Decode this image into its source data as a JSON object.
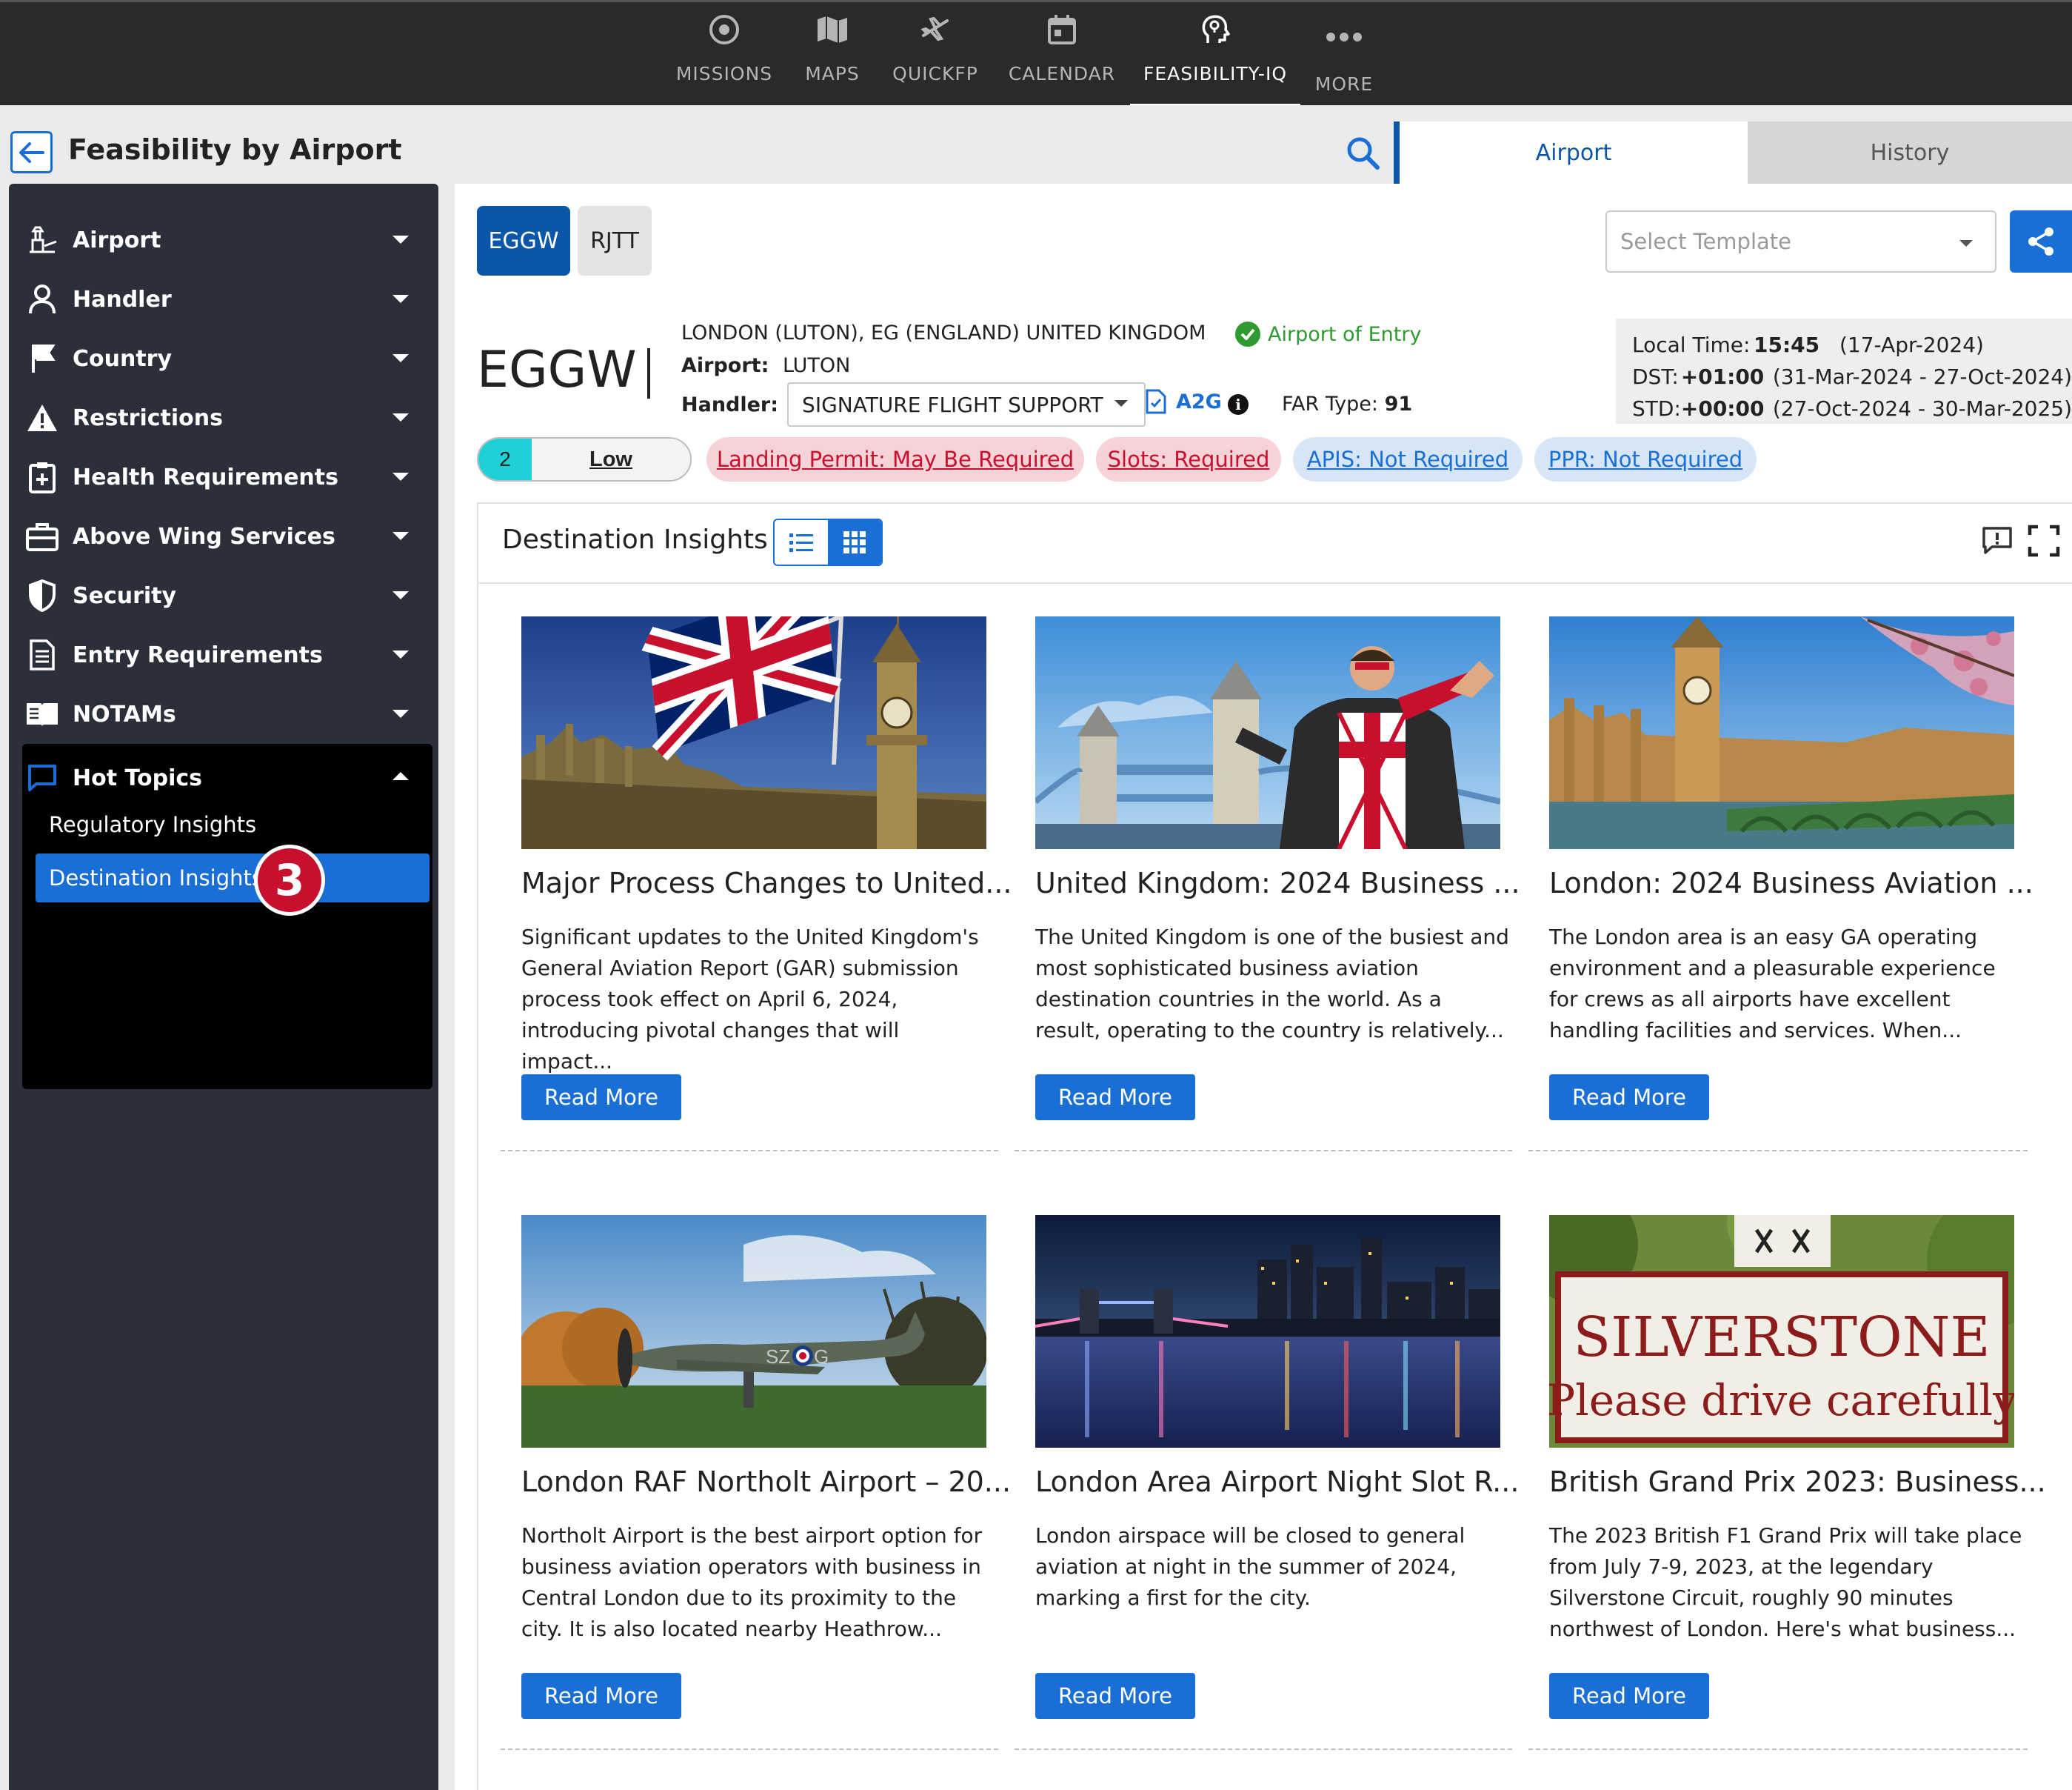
{
  "nav": {
    "items": [
      {
        "label": "MISSIONS",
        "icon": "target-icon"
      },
      {
        "label": "MAPS",
        "icon": "map-icon"
      },
      {
        "label": "QUICKFP",
        "icon": "plane-icon"
      },
      {
        "label": "CALENDAR",
        "icon": "calendar-icon"
      },
      {
        "label": "FEASIBILITY-IQ",
        "icon": "brain-head-icon"
      },
      {
        "label": "MORE",
        "icon": "more-icon"
      }
    ],
    "active": "FEASIBILITY-IQ"
  },
  "header": {
    "title": "Feasibility by Airport",
    "tabs": [
      {
        "label": "Airport"
      },
      {
        "label": "History"
      }
    ],
    "active_tab": "Airport"
  },
  "sidebar": {
    "items": [
      {
        "label": "Airport",
        "icon": "airport-icon"
      },
      {
        "label": "Handler",
        "icon": "person-icon"
      },
      {
        "label": "Country",
        "icon": "flag-icon"
      },
      {
        "label": "Restrictions",
        "icon": "warning-icon"
      },
      {
        "label": "Health Requirements",
        "icon": "health-clipboard-icon"
      },
      {
        "label": "Above Wing Services",
        "icon": "briefcase-icon"
      },
      {
        "label": "Security",
        "icon": "shield-icon"
      },
      {
        "label": "Entry Requirements",
        "icon": "document-icon"
      },
      {
        "label": "NOTAMs",
        "icon": "book-icon"
      }
    ],
    "hot_topics": {
      "label": "Hot Topics",
      "icon": "chat-icon",
      "sub_items": [
        {
          "label": "Regulatory Insights"
        },
        {
          "label": "Destination Insights"
        }
      ],
      "active": "Destination Insights"
    },
    "step_badge": "3"
  },
  "airport_codes": [
    "EGGW",
    "RJTT"
  ],
  "active_code": "EGGW",
  "template_placeholder": "Select Template",
  "airport": {
    "code": "EGGW",
    "location": "LONDON (LUTON), EG (ENGLAND) UNITED KINGDOM",
    "airport_of_entry": "Airport of Entry",
    "airport_label": "Airport:",
    "airport_name": "LUTON",
    "handler_label": "Handler:",
    "handler_value": "SIGNATURE FLIGHT SUPPORT",
    "a2g": "A2G",
    "far_label": "FAR Type:",
    "far_value": "91"
  },
  "time": {
    "local_label": "Local Time:",
    "local_value": "15:45",
    "local_date": "(17-Apr-2024)",
    "dst_label": "DST:",
    "dst_value": "+01:00",
    "dst_range": "(31-Mar-2024 - 27-Oct-2024)",
    "std_label": "STD:",
    "std_value": "+00:00",
    "std_range": "(27-Oct-2024 - 30-Mar-2025)"
  },
  "risk": {
    "score": "2",
    "level": "Low"
  },
  "pills": [
    {
      "label": "Landing Permit: May Be Required",
      "color": "#c8102e"
    },
    {
      "label": "Slots: Required",
      "color": "#c8102e"
    },
    {
      "label": "APIS: Not Required",
      "color": "#1a6fd6"
    },
    {
      "label": "PPR: Not Required",
      "color": "#1a6fd6"
    }
  ],
  "insights": {
    "title": "Destination Insights",
    "read_more": "Read More",
    "articles": [
      {
        "title": "Major Process Changes to United...",
        "body": "Significant updates to the United Kingdom's General Aviation Report (GAR) submission process took effect on April 6, 2024, introducing pivotal changes that will impact..."
      },
      {
        "title": "United Kingdom: 2024 Business ...",
        "body": "The United Kingdom is one of the busiest and most sophisticated business aviation destination countries in the world. As a result, operating to the country is relatively..."
      },
      {
        "title": "London: 2024 Business Aviation ...",
        "body": "The London area is an easy GA operating environment and a pleasurable experience for crews as all airports have excellent handling facilities and services. When..."
      },
      {
        "title": "London RAF Northolt Airport – 20...",
        "body": "Northolt Airport is the best airport option for business aviation operators with business in Central London due to its proximity to the city. It is also located nearby Heathrow..."
      },
      {
        "title": "London Area Airport Night Slot R...",
        "body": "London airspace will be closed to general aviation at night in the summer of 2024, marking a first for the city."
      },
      {
        "title": "British Grand Prix 2023: Business...",
        "body": "The 2023 British F1 Grand Prix will take place from July 7-9, 2023, at the legendary Silverstone Circuit, roughly 90 minutes northwest of London. Here's what business..."
      }
    ],
    "sign_line1": "SILVERSTONE",
    "sign_line2": "Please drive carefully"
  }
}
